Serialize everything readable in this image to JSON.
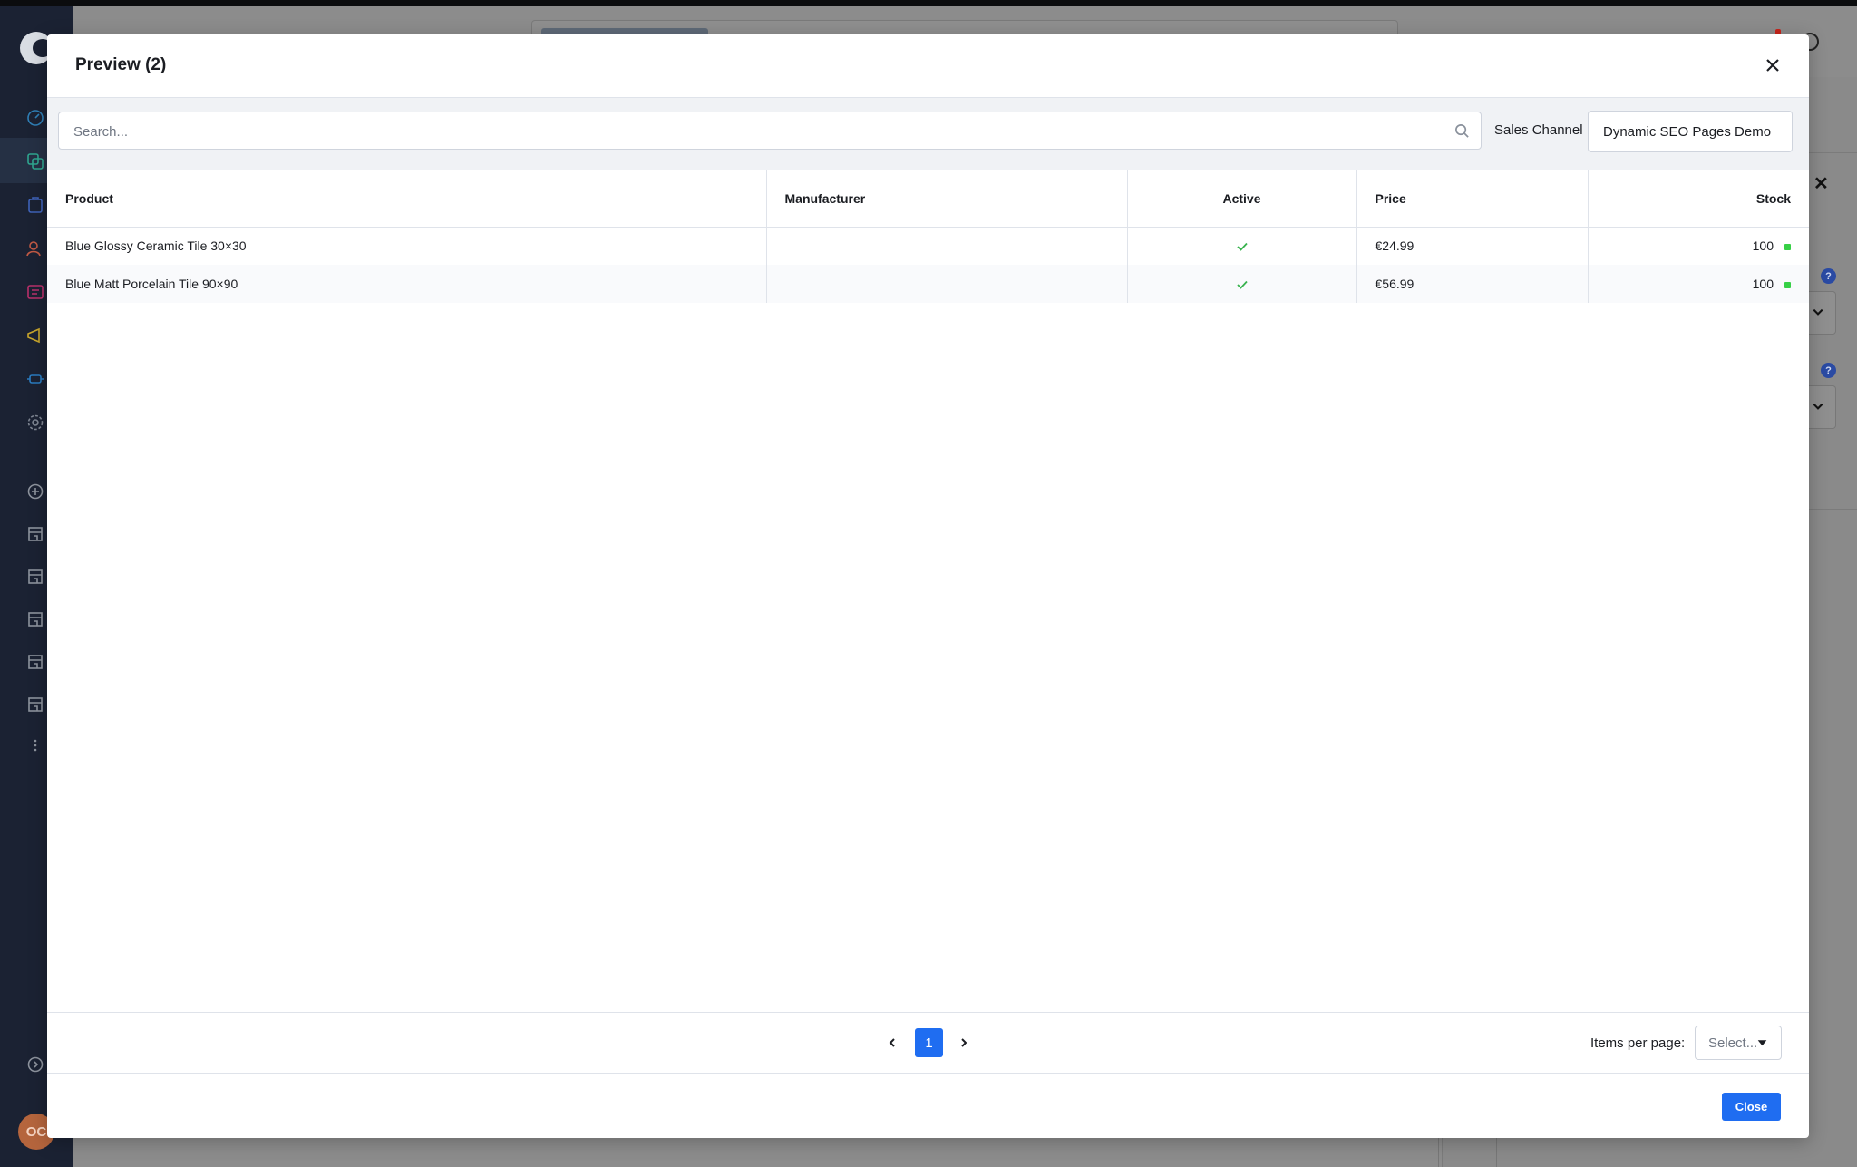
{
  "modal": {
    "title": "Preview (2)",
    "search_placeholder": "Search...",
    "sales_channel_label": "Sales Channel",
    "sales_channel_value": "Dynamic SEO Pages Demo",
    "columns": [
      "Product",
      "Manufacturer",
      "Active",
      "Price",
      "Stock"
    ],
    "rows": [
      {
        "product": "Blue Glossy Ceramic Tile 30×30",
        "manufacturer": "",
        "active": true,
        "price": "€24.99",
        "stock": "100"
      },
      {
        "product": "Blue Matt Porcelain Tile 90×90",
        "manufacturer": "",
        "active": true,
        "price": "€56.99",
        "stock": "100"
      }
    ],
    "pagination": {
      "current_page": "1"
    },
    "items_per_page_label": "Items per page:",
    "items_per_page_placeholder": "Select...",
    "close_label": "Close"
  },
  "app": {
    "avatar_initials": "OC"
  },
  "colors": {
    "accent": "#1f6df1",
    "sidebar_bg": "#1b2233",
    "stock_ok": "#37d046",
    "check": "#37b24d"
  }
}
